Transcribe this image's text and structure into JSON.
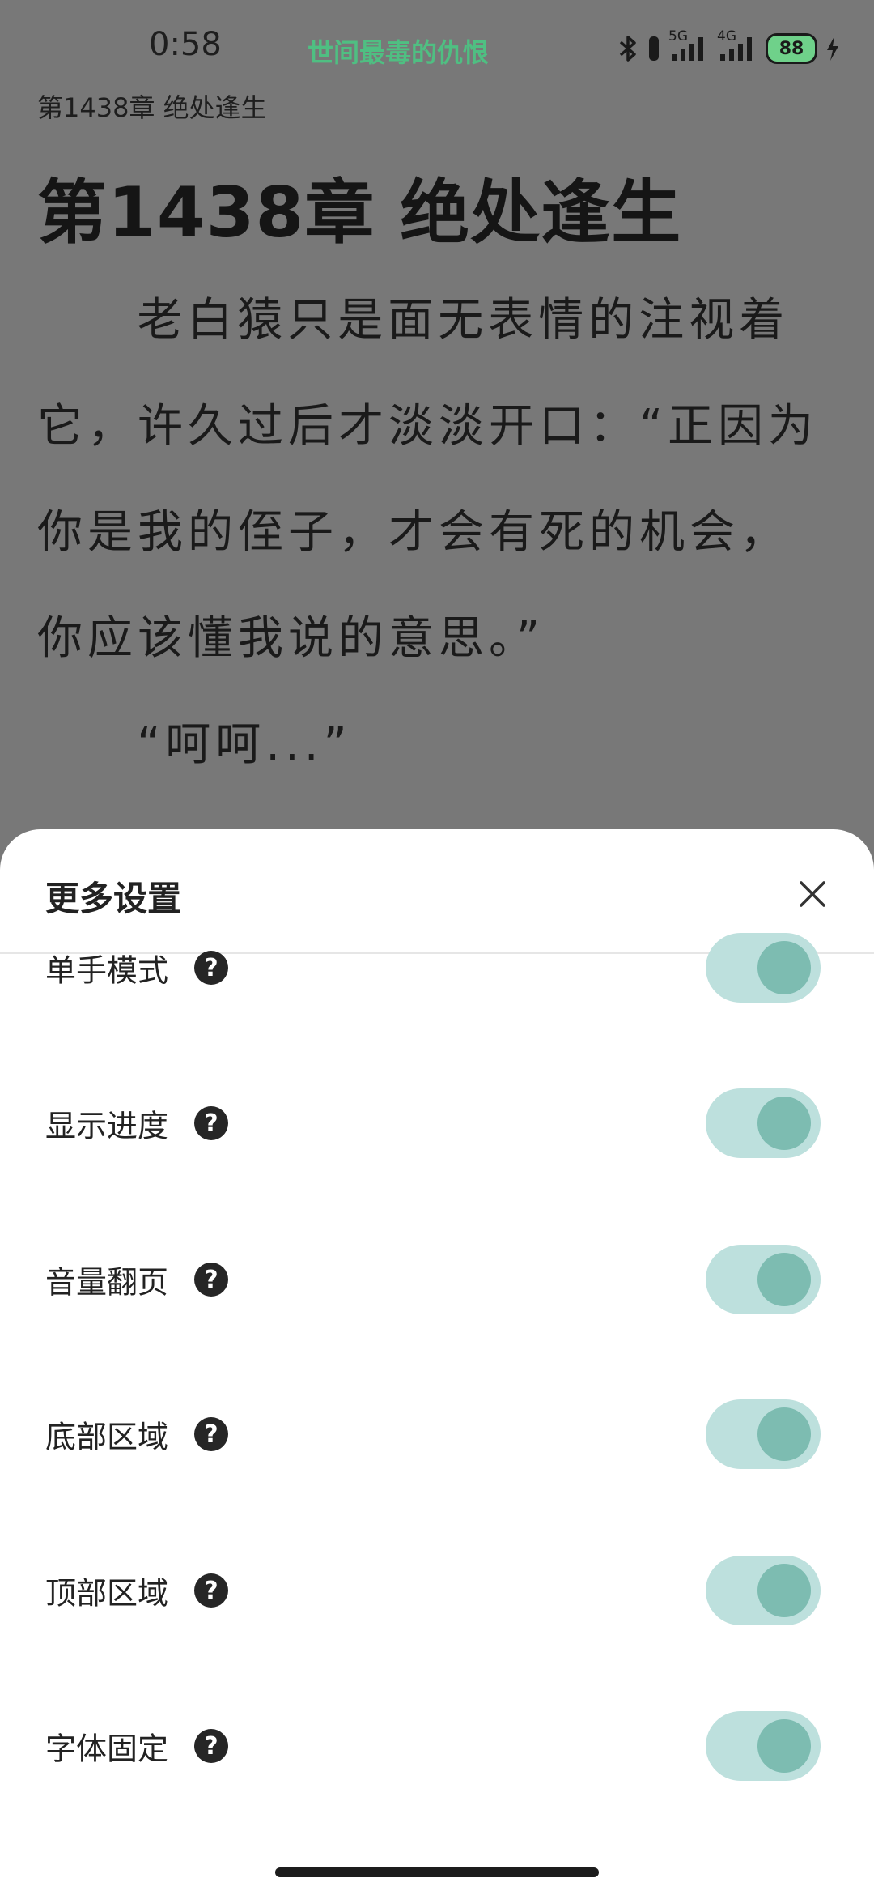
{
  "status_bar": {
    "time": "0:58",
    "book_title": "世间最毒的仇恨",
    "network_1": "5G",
    "network_2": "4G",
    "battery": "88",
    "icons": [
      "bluetooth-icon",
      "vibrate-icon",
      "signal-5g-icon",
      "signal-4g-icon",
      "battery-icon",
      "charging-icon"
    ]
  },
  "reader": {
    "chapter_header": "第1438章 绝处逢生",
    "chapter_title": "第1438章 绝处逢生",
    "paragraphs": [
      "老白猿只是面无表情的注视着它，许久过后才淡淡开口：“正因为你是我的侄子，才会有死的机会，你应该懂我说的意思。”",
      "“呵呵...”"
    ]
  },
  "settings_sheet": {
    "title": "更多设置",
    "items": [
      {
        "label": "单手模式",
        "enabled": true
      },
      {
        "label": "显示进度",
        "enabled": true
      },
      {
        "label": "音量翻页",
        "enabled": true
      },
      {
        "label": "底部区域",
        "enabled": true
      },
      {
        "label": "顶部区域",
        "enabled": true
      },
      {
        "label": "字体固定",
        "enabled": true
      }
    ],
    "help_symbol": "?"
  },
  "colors": {
    "accent_title": "#4fbf82",
    "toggle_track": "#bde0dd",
    "toggle_knob": "#7dbcb1"
  }
}
